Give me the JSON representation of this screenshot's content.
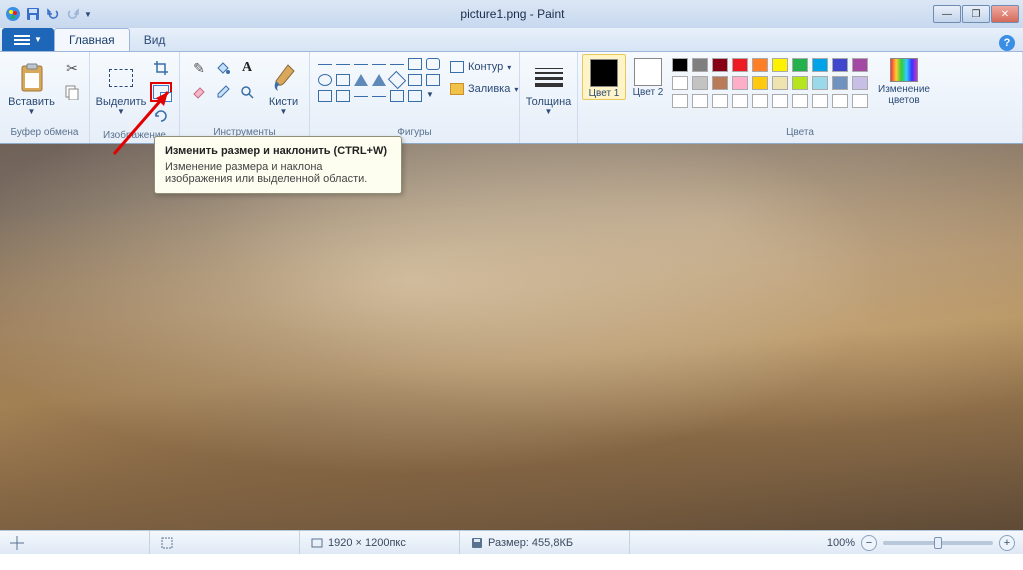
{
  "title": "picture1.png - Paint",
  "tabs": {
    "file": "",
    "home": "Главная",
    "view": "Вид"
  },
  "groups": {
    "clipboard": {
      "label": "Буфер обмена",
      "paste": "Вставить"
    },
    "image": {
      "label": "Изображение",
      "select": "Выделить"
    },
    "tools": {
      "label": "Инструменты",
      "brushes": "Кисти"
    },
    "shapes": {
      "label": "Фигуры",
      "outline": "Контур",
      "fill": "Заливка"
    },
    "thickness": {
      "label": "Толщина"
    },
    "colors": {
      "label": "Цвета",
      "c1": "Цвет 1",
      "c2": "Цвет 2",
      "edit": "Изменение цветов"
    }
  },
  "palette_row1": [
    "#000000",
    "#7f7f7f",
    "#880015",
    "#ed1c24",
    "#ff7f27",
    "#fff200",
    "#22b14c",
    "#00a2e8",
    "#3f48cc",
    "#a349a4"
  ],
  "palette_row2": [
    "#ffffff",
    "#c3c3c3",
    "#b97a57",
    "#ffaec9",
    "#ffc90e",
    "#efe4b0",
    "#b5e61d",
    "#99d9ea",
    "#7092be",
    "#c8bfe7"
  ],
  "color1": "#000000",
  "color2": "#ffffff",
  "tooltip": {
    "title": "Изменить размер и наклонить (CTRL+W)",
    "body": "Изменение размера и наклона изображения или выделенной области."
  },
  "status": {
    "dims": "1920 × 1200пкс",
    "size": "Размер: 455,8КБ",
    "zoom": "100%"
  }
}
